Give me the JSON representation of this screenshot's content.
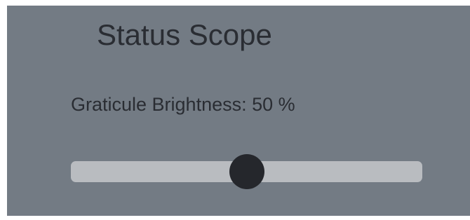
{
  "panel": {
    "title": "Status Scope",
    "setting_name": "Graticule Brightness",
    "setting_value_text": "50 %",
    "slider": {
      "value_percent": 50
    }
  },
  "colors": {
    "panel_bg": "#737b84",
    "text": "#2a2d33",
    "track": "#b9bcc0",
    "thumb": "#25272c"
  }
}
